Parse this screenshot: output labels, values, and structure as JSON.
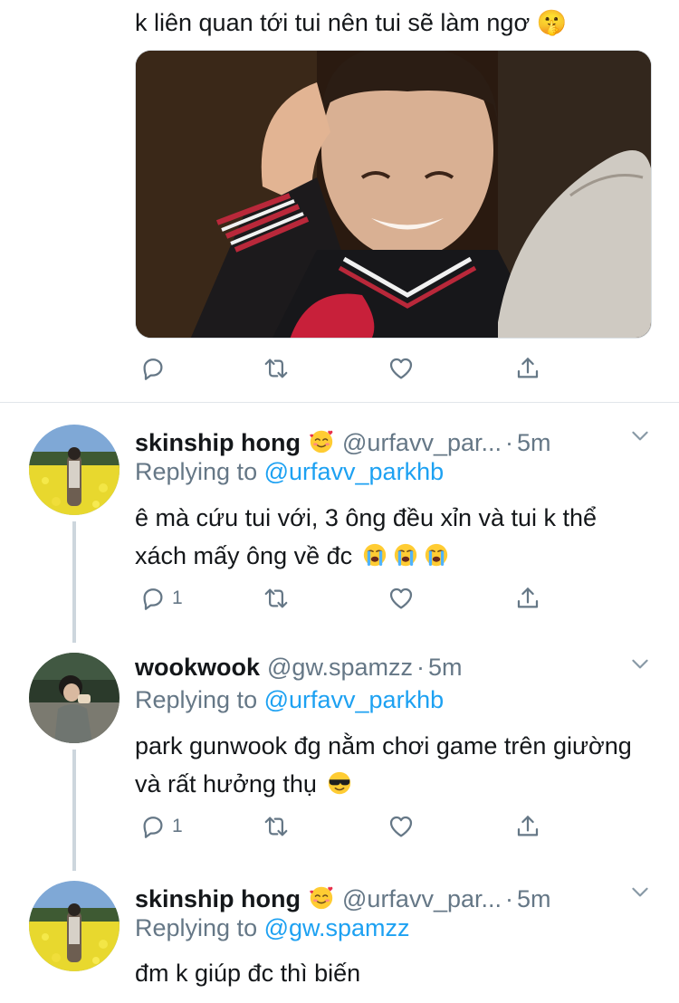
{
  "top_tweet": {
    "text": "k liên quan tới tui nên tui sẽ làm ngơ 🤫",
    "media_alt": "photo"
  },
  "icons": {
    "reply": "reply-icon",
    "retweet": "retweet-icon",
    "like": "heart-icon",
    "share": "share-icon",
    "more": "chevron-down-icon"
  },
  "colors": {
    "link": "#1da1f2",
    "secondary_text": "#657786",
    "primary_text": "#14171a",
    "thread_line": "#cdd6dd"
  },
  "tweets": [
    {
      "name": "skinship hong",
      "name_emoji": "smiling-face-with-hearts",
      "handle": "@urfavv_par...",
      "dot": "·",
      "time": "5m",
      "replying_prefix": "Replying to ",
      "replying_to": "@urfavv_parkhb",
      "text": "ê mà cứu tui với, 3 ông đều xỉn và tui k thể xách mấy ông về đc",
      "text_emojis": [
        "loudly-crying-face",
        "loudly-crying-face",
        "loudly-crying-face"
      ],
      "reply_count": "1"
    },
    {
      "name": "wookwook",
      "handle": "@gw.spamzz",
      "dot": "·",
      "time": "5m",
      "replying_prefix": "Replying to ",
      "replying_to": "@urfavv_parkhb",
      "text": "park gunwook đg nằm chơi game trên giường và rất hưởng thụ",
      "text_emojis": [
        "smiling-face-with-sunglasses"
      ],
      "reply_count": "1"
    },
    {
      "name": "skinship hong",
      "name_emoji": "smiling-face-with-hearts",
      "handle": "@urfavv_par...",
      "dot": "·",
      "time": "5m",
      "replying_prefix": "Replying to ",
      "replying_to": "@gw.spamzz",
      "text": "đm k giúp đc thì biến"
    }
  ]
}
